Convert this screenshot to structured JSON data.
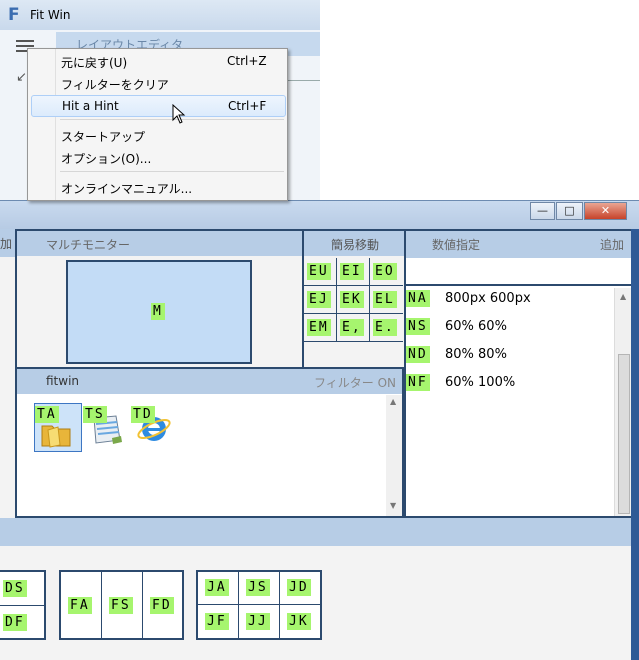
{
  "back_window": {
    "logo": "F",
    "title": "Fit Win",
    "tab_label": "レイアウトエディタ"
  },
  "menu": {
    "items": [
      {
        "label": "元に戻す(U)",
        "shortcut": "Ctrl+Z"
      },
      {
        "label": "フィルターをクリア",
        "shortcut": ""
      },
      {
        "label": "Hit a Hint",
        "shortcut": "Ctrl+F",
        "highlighted": true
      },
      {
        "label": "スタートアップ",
        "shortcut": ""
      },
      {
        "label": "オプション(O)...",
        "shortcut": ""
      },
      {
        "label": "オンラインマニュアル...",
        "shortcut": ""
      }
    ]
  },
  "front_window": {
    "buttons": {
      "minimize": "—",
      "maximize": "□",
      "close": "✕"
    },
    "left_partial_label": "加",
    "multi_monitor": {
      "title": "マルチモニター",
      "monitor_hint": "M"
    },
    "quick_move": {
      "title": "簡易移動",
      "hints": [
        "EU",
        "EI",
        "EO",
        "EJ",
        "EK",
        "EL",
        "EM",
        "E,",
        "E."
      ]
    },
    "numeric": {
      "title": "数値指定",
      "add_label": "追加",
      "input_value": "",
      "rows": [
        {
          "hint": "NA",
          "value": "800px 600px"
        },
        {
          "hint": "NS",
          "value": "60% 60%"
        },
        {
          "hint": "ND",
          "value": "80% 80%"
        },
        {
          "hint": "NF",
          "value": "60% 100%"
        }
      ]
    },
    "fitwin": {
      "title": "fitwin",
      "filter_label": "フィルター ON",
      "apps": [
        {
          "hint": "TA",
          "icon": "folder-icon"
        },
        {
          "hint": "TS",
          "icon": "notepad-icon"
        },
        {
          "hint": "TD",
          "icon": "internet-explorer-icon"
        }
      ]
    },
    "bottom_grids": {
      "left": [
        "DS",
        "DF"
      ],
      "middle": [
        "FA",
        "FS",
        "FD"
      ],
      "right": [
        "JA",
        "JS",
        "JD",
        "JF",
        "JJ",
        "JK"
      ]
    }
  },
  "colors": {
    "hint_bg": "#a6f56e",
    "panel_border": "#2c4a6e",
    "header_bg": "#b7cde6",
    "monitor_bg": "#c3dcf6"
  }
}
